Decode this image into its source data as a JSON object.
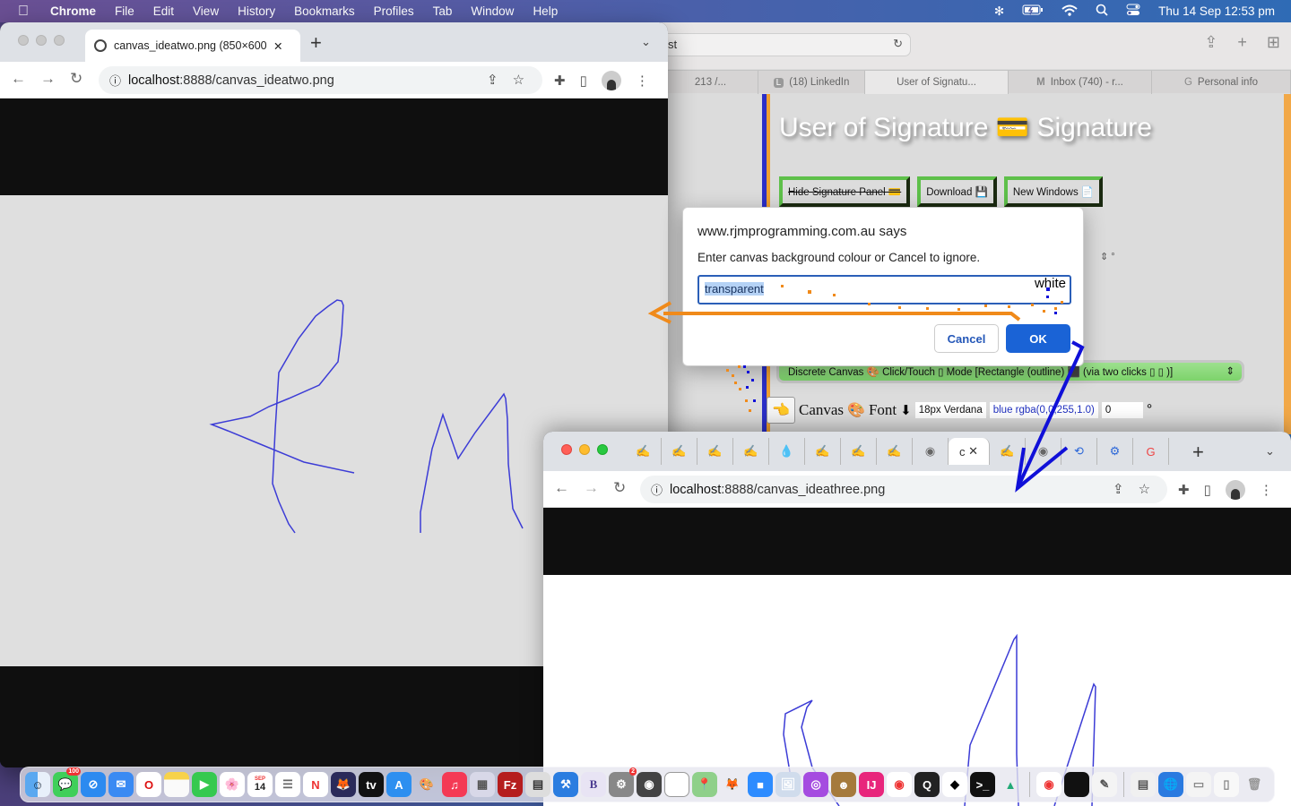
{
  "menubar": {
    "app": "Chrome",
    "items": [
      "File",
      "Edit",
      "View",
      "History",
      "Bookmarks",
      "Profiles",
      "Tab",
      "Window",
      "Help"
    ],
    "status_icons": [
      "bluetooth-icon",
      "battery-charging-icon",
      "wifi-icon",
      "spotlight-search-icon",
      "control-center-icon"
    ],
    "clock": "Thu 14 Sep  12:53 pm"
  },
  "safari": {
    "url_fragment": "st",
    "tabs": [
      {
        "label": "213 /...",
        "icon": ""
      },
      {
        "label": "(18) LinkedIn",
        "icon": "L"
      },
      {
        "label": "User of Signatu...",
        "icon": "",
        "active": true
      },
      {
        "label": "Inbox (740) - r...",
        "icon": "M"
      },
      {
        "label": "Personal info",
        "icon": "G"
      }
    ],
    "page": {
      "title": "User of Signature 💳 Signature",
      "buttons": [
        "Hide Signature Panel 💳",
        "Download 💾",
        "New Windows 📄"
      ],
      "mode_select": "Discrete Canvas 🎨 Click/Touch ▯  Mode [Rectangle (outline) ⬛ (via two clicks ▯ ▯ )]",
      "canvas_label": "Canvas",
      "font_label": "Font",
      "font_value": "18px Verdana",
      "color_value": "blue rgba(0,0,255,1.0)",
      "rotation_value": "0",
      "degree": "°"
    }
  },
  "dialog": {
    "origin": "www.rjmprogramming.com.au says",
    "message": "Enter canvas background colour or Cancel to ignore.",
    "input_value": "transparent",
    "annotation": "white",
    "cancel_label": "Cancel",
    "ok_label": "OK"
  },
  "chrome1": {
    "tab_title": "canvas_ideatwo.png (850×600)",
    "url_host": "localhost",
    "url_path": ":8888/canvas_ideatwo.png",
    "new_tab": "+"
  },
  "chrome2": {
    "active_tab": "c",
    "url_host": "localhost",
    "url_path": ":8888/canvas_ideathree.png",
    "new_tab": "+"
  },
  "dock": {
    "messages_badge": "100",
    "calendar_day": "14",
    "calendar_month": "SEP",
    "settings_badge": "2",
    "apps": [
      "Finder",
      "Messages",
      "Safari",
      "Mail",
      "Opera",
      "Notes",
      "FaceTime",
      "Photos",
      "Calendar",
      "Reminders",
      "News",
      "Firefox",
      "Apple TV",
      "App Store",
      "Paintbrush",
      "Music",
      "Launchpad",
      "FileZilla",
      "Calculator",
      "Xcode",
      "BBEdit",
      "System Settings",
      "MAMP",
      "LibreOffice",
      "Maps",
      "GIMP",
      "Zoom",
      "Preview",
      "Podcasts",
      "Contacts",
      "IntelliJ IDEA",
      "Chrome",
      "QuickTime",
      "Inkscape",
      "Terminal",
      "Cabri",
      "Chrome",
      "Terminal",
      "TextEdit",
      "Document",
      "Globe",
      "Downloads",
      "Stack",
      "Trash"
    ]
  },
  "accent": {
    "ok_blue": "#1a63d6",
    "stroke_blue": "#3c3cd6",
    "orange": "#f08a1a",
    "green": "#5ec04a"
  }
}
